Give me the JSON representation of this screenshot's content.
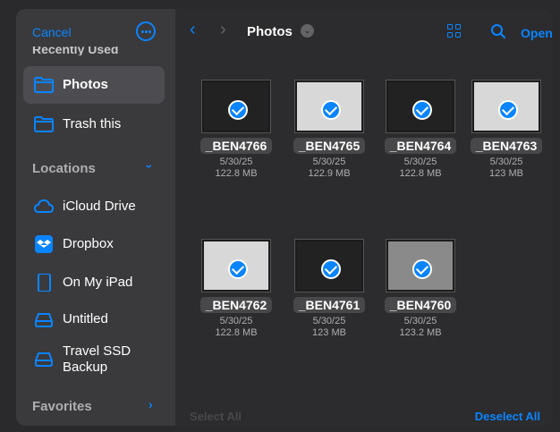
{
  "header": {
    "cancel_label": "Cancel",
    "recent_cut_label": "Recently Used",
    "title": "Photos",
    "open_label": "Open"
  },
  "sidebar": {
    "top_items": [
      {
        "label": "Photos",
        "icon": "folder-icon",
        "selected": true
      },
      {
        "label": "Trash this",
        "icon": "folder-icon",
        "selected": false
      }
    ],
    "locations_header": "Locations",
    "locations": [
      {
        "label": "iCloud Drive",
        "icon": "cloud-icon"
      },
      {
        "label": "Dropbox",
        "icon": "dropbox-icon"
      },
      {
        "label": "On My iPad",
        "icon": "ipad-icon"
      },
      {
        "label": "Untitled",
        "icon": "drive-icon"
      },
      {
        "label": "Travel SSD\nBackup",
        "icon": "drive-icon"
      }
    ],
    "favorites_header": "Favorites"
  },
  "files": [
    {
      "name": "_BEN4766",
      "date": "5/30/25",
      "size": "122.8 MB",
      "selected": true,
      "tone": "dark"
    },
    {
      "name": "_BEN4765",
      "date": "5/30/25",
      "size": "122.9 MB",
      "selected": true,
      "tone": "light"
    },
    {
      "name": "_BEN4764",
      "date": "5/30/25",
      "size": "122.8 MB",
      "selected": true,
      "tone": "dark"
    },
    {
      "name": "_BEN4763",
      "date": "5/30/25",
      "size": "123 MB",
      "selected": true,
      "tone": "light"
    },
    {
      "name": "_BEN4762",
      "date": "5/30/25",
      "size": "122.8 MB",
      "selected": true,
      "tone": "light"
    },
    {
      "name": "_BEN4761",
      "date": "5/30/25",
      "size": "123 MB",
      "selected": true,
      "tone": "dark"
    },
    {
      "name": "_BEN4760",
      "date": "5/30/25",
      "size": "123.2 MB",
      "selected": true,
      "tone": "mid"
    }
  ],
  "footer": {
    "select_all": "Select All",
    "deselect_all": "Deselect All"
  },
  "colors": {
    "accent": "#0a84ff",
    "sidebar_bg": "#3a3a3c",
    "main_bg": "#2c2c2e"
  }
}
